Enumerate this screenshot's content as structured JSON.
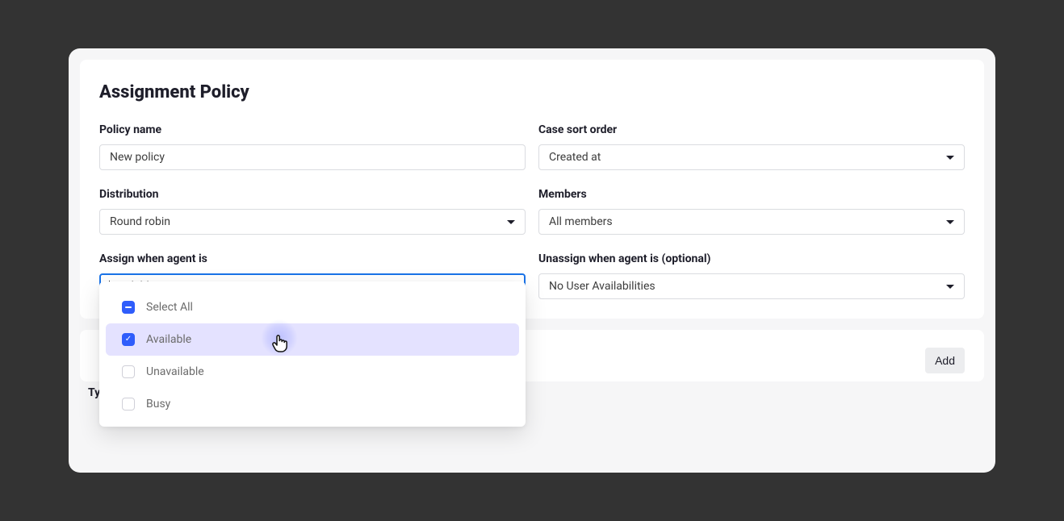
{
  "page": {
    "title": "Assignment Policy"
  },
  "form": {
    "policy_name": {
      "label": "Policy name",
      "value": "New policy"
    },
    "case_sort_order": {
      "label": "Case sort order",
      "value": "Created at"
    },
    "distribution": {
      "label": "Distribution",
      "value": "Round robin"
    },
    "members": {
      "label": "Members",
      "value": "All members"
    },
    "assign_when": {
      "label": "Assign when agent is",
      "value": "Available",
      "options": {
        "select_all": "Select All",
        "available": "Available",
        "unavailable": "Unavailable",
        "busy": "Busy"
      }
    },
    "unassign_when": {
      "label": "Unassign when agent is (optional)",
      "value": "No User Availabilities"
    }
  },
  "actions": {
    "add": "Add"
  },
  "sections": {
    "type": "Type"
  }
}
